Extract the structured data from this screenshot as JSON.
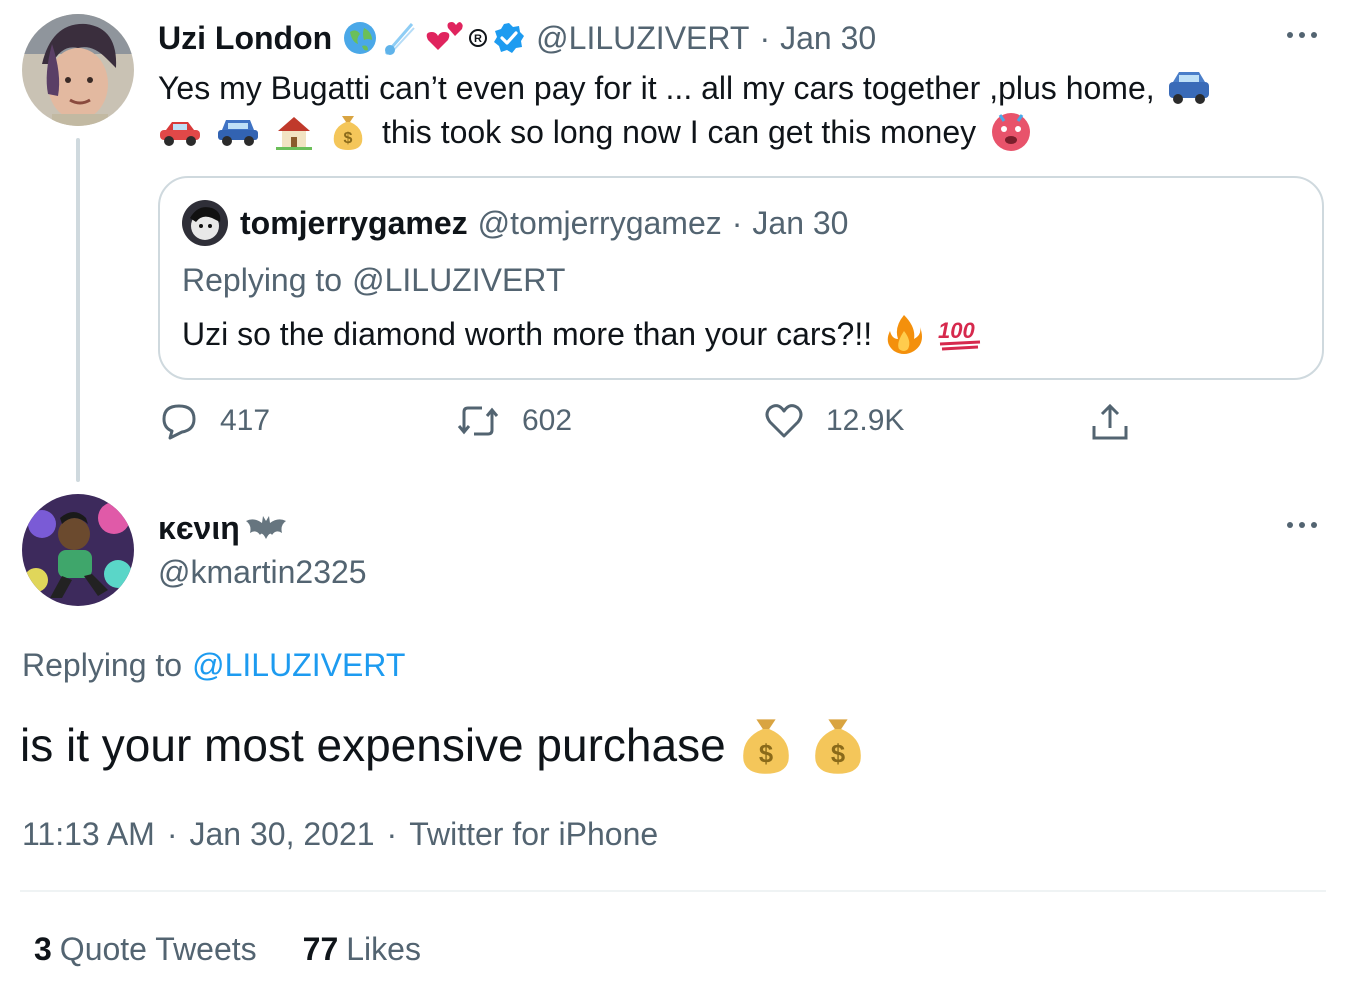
{
  "original": {
    "name": "Uzi London",
    "handle": "@LILUZIVERT",
    "date": "Jan 30",
    "line1": "Yes my Bugatti can’t even pay for it ... all my cars together ,plus home,",
    "line2": "this took so long now I can get this money",
    "name_emojis": [
      "globe-icon",
      "comet-icon",
      "hearts-icon",
      "registered-icon",
      "verified-badge"
    ],
    "actions": {
      "replies": "417",
      "retweets": "602",
      "likes": "12.9K"
    }
  },
  "quote": {
    "name": "tomjerrygamez",
    "handle": "@tomjerrygamez",
    "date": "Jan 30",
    "replying_prefix": "Replying to",
    "replying_handle": "@LILUZIVERT",
    "text": "Uzi so the diamond worth more than your cars?!!"
  },
  "reply": {
    "name": "κєνιη",
    "handle": "@kmartin2325",
    "replying_prefix": "Replying to",
    "replying_handle": "@LILUZIVERT",
    "text": "is it your most expensive purchase",
    "timestamp": "11:13 AM",
    "date": "Jan 30, 2021",
    "source": "Twitter for iPhone"
  },
  "stats": {
    "quote_count": "3",
    "quote_label": "Quote Tweets",
    "like_count": "77",
    "like_label": "Likes"
  },
  "colors": {
    "link": "#1d9bf0",
    "muted": "#536471",
    "border": "#cfd9de",
    "verified": "#1d9bf0"
  }
}
